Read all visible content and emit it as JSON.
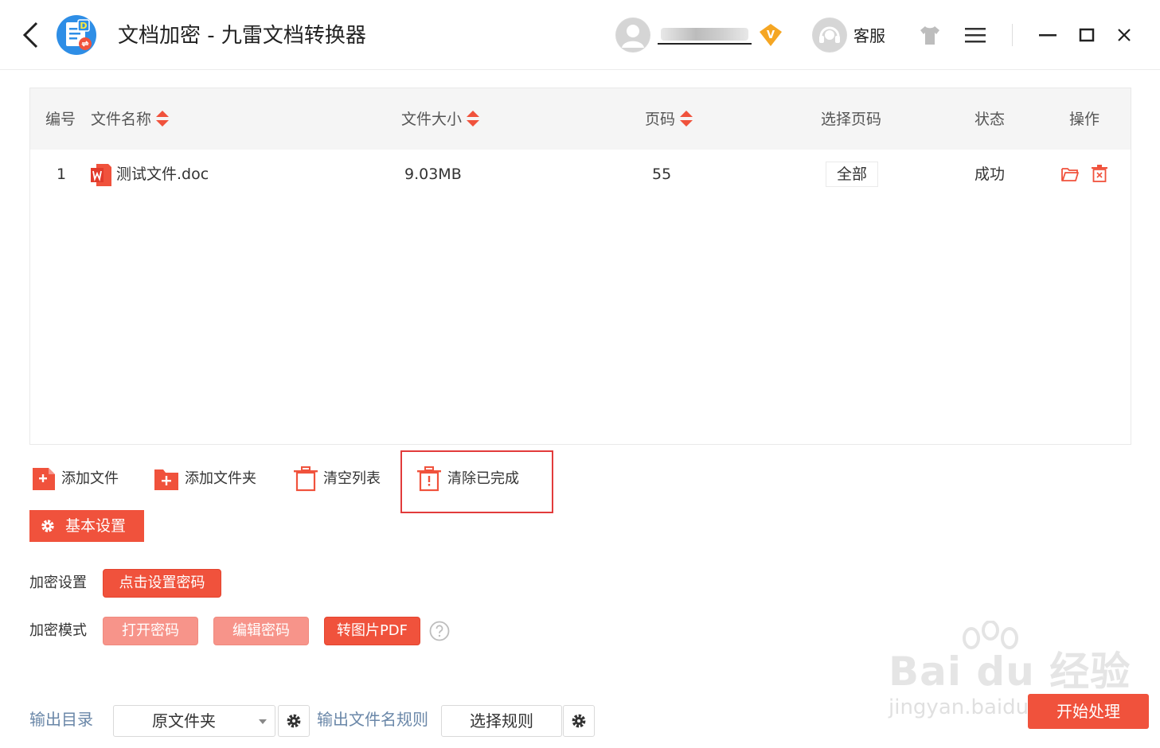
{
  "window": {
    "title": "文档加密 - 九雷文档转换器",
    "customer_service": "客服"
  },
  "colors": {
    "accent": "#f0523c",
    "accent_light": "#f7948a",
    "highlight_box": "#e23b3b",
    "vip_badge": "#f5a623",
    "muted_link": "#6a87a8"
  },
  "table": {
    "columns": {
      "index": "编号",
      "name": "文件名称",
      "size": "文件大小",
      "pages": "页码",
      "select_pages": "选择页码",
      "status": "状态",
      "actions": "操作"
    },
    "rows": [
      {
        "index": "1",
        "name": "测试文件.doc",
        "size": "9.03MB",
        "pages": "55",
        "select_pages": "全部",
        "status": "成功"
      }
    ]
  },
  "toolbar": {
    "add_file": "添加文件",
    "add_folder": "添加文件夹",
    "clear_list": "清空列表",
    "clear_done": "清除已完成"
  },
  "settings": {
    "basic_settings": "基本设置",
    "encrypt_settings_label": "加密设置",
    "set_password_button": "点击设置密码",
    "encrypt_mode_label": "加密模式",
    "modes": [
      "打开密码",
      "编辑密码",
      "转图片PDF"
    ]
  },
  "output": {
    "dir_label": "输出目录",
    "dir_value": "原文件夹",
    "filename_rule_label": "输出文件名规则",
    "rule_button": "选择规则",
    "start_button": "开始处理"
  },
  "watermark": {
    "line1": "Bai du 经验",
    "line2": "jingyan.baidu.com"
  }
}
